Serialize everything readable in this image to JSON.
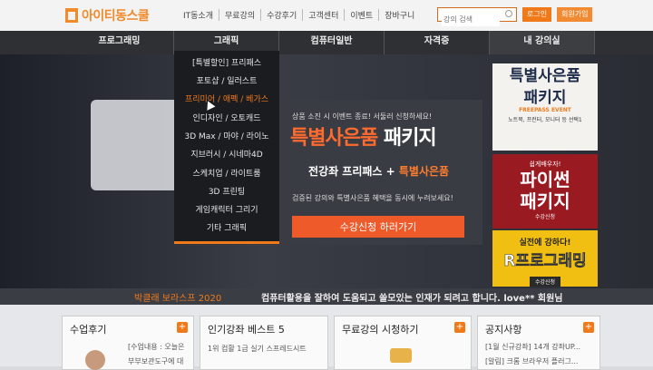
{
  "header": {
    "logo_text": "아이티동스쿨",
    "top_nav": [
      "IT동소개",
      "무료강의",
      "수강후기",
      "고객센터",
      "이벤트",
      "장바구니"
    ],
    "search_placeholder": "강의 검색",
    "login_label": "로그인",
    "join_label": "회원가입"
  },
  "main_nav": [
    "프로그래밍",
    "그래픽",
    "컴퓨터일반",
    "자격증",
    "내 강의실"
  ],
  "dropdown": [
    "[특별할인] 프리패스",
    "포토샵 / 일러스트",
    "프리미어 / 애펙 / 베가스",
    "인디자인 / 오토캐드",
    "3D Max / 마야 / 라이노",
    "지브러시 / 시네마4D",
    "스케치업 / 라이트룸",
    "3D 프린팅",
    "게임캐릭터 그리기",
    "기타 그래픽"
  ],
  "hero": {
    "sub": "상품 소진 시 이벤트 종료! 서둘러 신청하세요!",
    "title_orange": "특별사은품",
    "title_white": "패키지",
    "line_white": "전강좌 프리패스 +",
    "line_orange": "특별사은품",
    "desc": "검증된 강의와 특별사은품 혜택을 동시에 누려보세요!",
    "cta": "수강신청 하러가기"
  },
  "side_banners": {
    "b1_title1": "특별사은품",
    "b1_title2": "패키지",
    "b1_tag": "FREEPASS EVENT",
    "b1_desc": "노트북, 프린터, 모니터 등 선택1",
    "b2_small": "쉽게배우자!",
    "b2_title1": "파이썬",
    "b2_title2": "패키지",
    "b2_foot": "수강신청",
    "b3_small": "실전에 강하다!",
    "b3_title": "R프로그래밍",
    "b3_foot": "수강신청"
  },
  "ticker": {
    "faded": "박클래 보라스프 2020",
    "text": "컴퓨터활용을 잘하여 도움되고 쓸모있는 인재가 되려고 합니다. love** 회원님"
  },
  "cards": [
    {
      "title": "수업후기",
      "lines": [
        "[수업내용 : 오늘은",
        "부부보관도구에 대"
      ]
    },
    {
      "title": "인기강좌 베스트 5",
      "lines": [
        "1위  컴활 1급 실기 스프레드시트"
      ]
    },
    {
      "title": "무료강의 시청하기",
      "lines": []
    },
    {
      "title": "공지사항",
      "lines": [
        "[1월 신규강좌] 14개 강좌UP...",
        "[알림] 크롬 브라우저 플러그..."
      ]
    }
  ]
}
